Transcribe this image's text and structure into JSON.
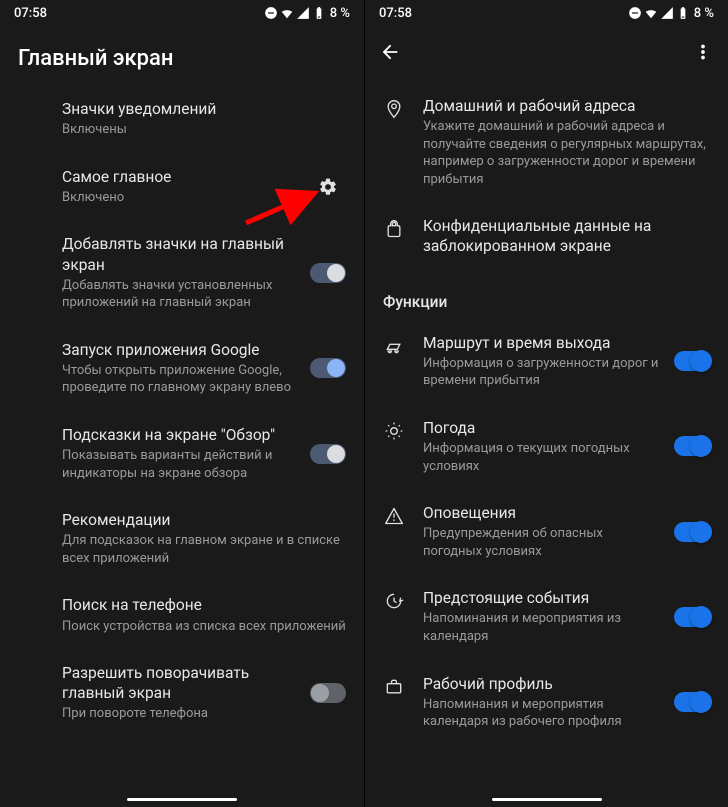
{
  "statusbar": {
    "time": "07:58",
    "battery": "8 %"
  },
  "left": {
    "page_title": "Главный экран",
    "items": [
      {
        "title": "Значки уведомлений",
        "sub": "Включены"
      },
      {
        "title": "Самое главное",
        "sub": "Включено"
      },
      {
        "title": "Добавлять значки на главный экран",
        "sub": "Добавлять значки установленных приложений на главный экран"
      },
      {
        "title": "Запуск приложения Google",
        "sub": "Чтобы открыть приложение Google, проведите по главному экрану влево"
      },
      {
        "title": "Подсказки на экране \"Обзор\"",
        "sub": "Показывать варианты действий и индикаторы на экране обзора"
      },
      {
        "title": "Рекомендации",
        "sub": "Для подсказок на главном экране и в списке всех приложений"
      },
      {
        "title": "Поиск на телефоне",
        "sub": "Поиск устройства из списка всех приложений"
      },
      {
        "title": "Разрешить поворачивать главный экран",
        "sub": "При повороте телефона"
      }
    ]
  },
  "right": {
    "top": [
      {
        "title": "Домашний и рабочий адреса",
        "sub": "Укажите домашний и рабочий адреса и получайте сведения о регулярных маршрутах, например о загруженности дорог и времени прибытия"
      },
      {
        "title": "Конфиденциальные данные на заблокированном экране",
        "sub": ""
      }
    ],
    "section": "Функции",
    "items": [
      {
        "title": "Маршрут и время выхода",
        "sub": "Информация о загруженности дорог и времени прибытия"
      },
      {
        "title": "Погода",
        "sub": "Информация о текущих погодных условиях"
      },
      {
        "title": "Оповещения",
        "sub": "Предупреждения об опасных погодных условиях"
      },
      {
        "title": "Предстоящие события",
        "sub": "Напоминания и мероприятия из календаря"
      },
      {
        "title": "Рабочий профиль",
        "sub": "Напоминания и мероприятия календаря из рабочего профиля"
      }
    ]
  }
}
